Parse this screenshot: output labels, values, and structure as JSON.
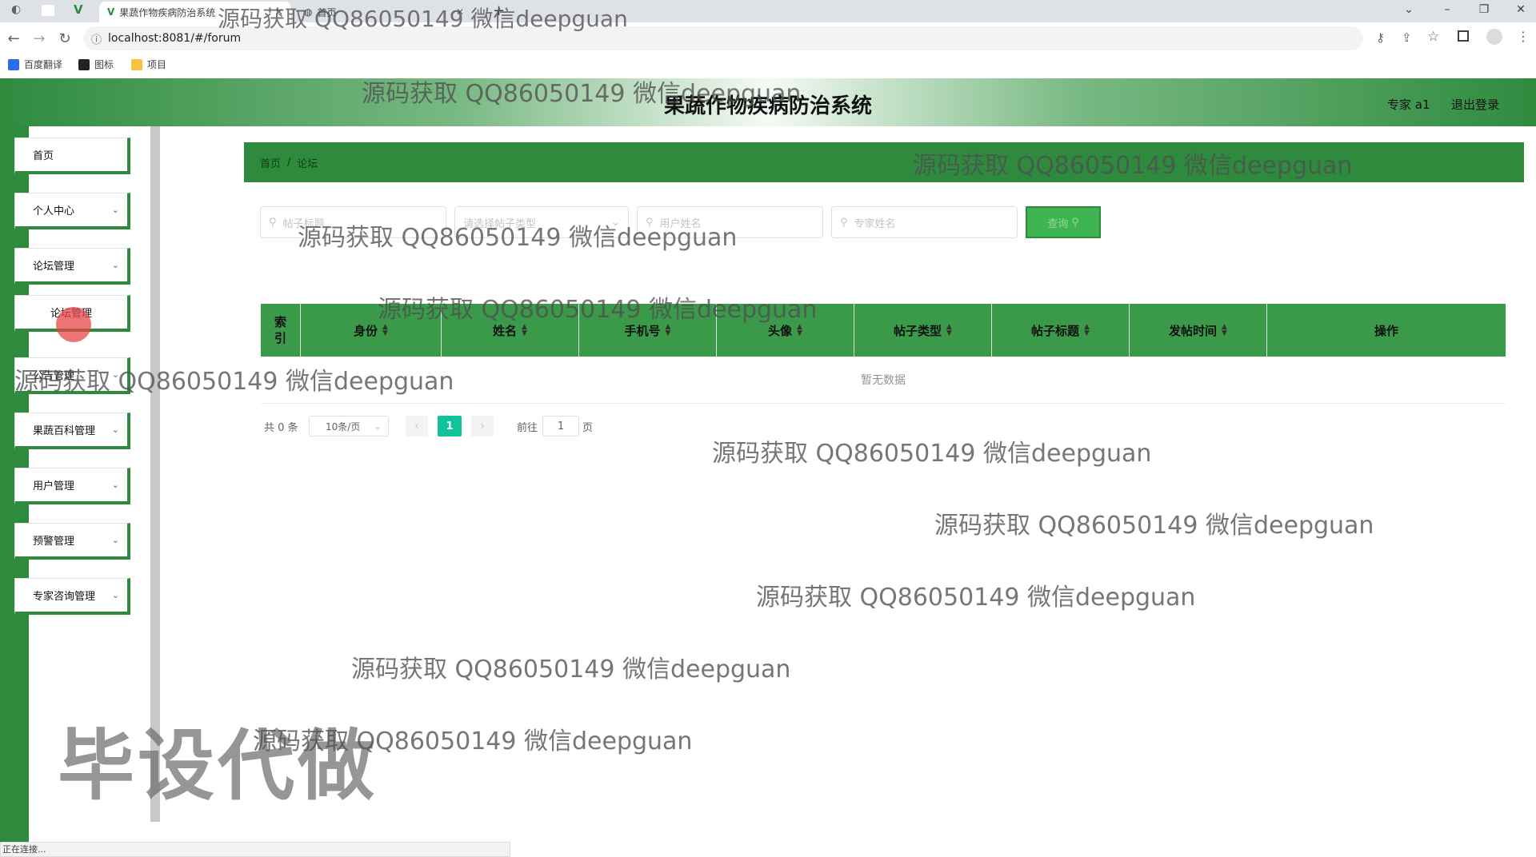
{
  "browser": {
    "tabs": [
      {
        "label": "果蔬作物疾病防治系统",
        "close": "✕",
        "active": true
      },
      {
        "label": "首页",
        "close": "✕",
        "active": false
      }
    ],
    "new_tab": "+",
    "url": "localhost:8081/#/forum",
    "bookmarks": [
      {
        "label": "百度翻译",
        "color": "#2b6de8"
      },
      {
        "label": "图标",
        "color": "#222222"
      },
      {
        "label": "项目",
        "color": "#f5c242"
      }
    ],
    "status_text": "正在连接..."
  },
  "app": {
    "title": "果蔬作物疾病防治系统",
    "user_label": "专家 a1",
    "logout_label": "退出登录",
    "theme_color": "#2e8b3e"
  },
  "sidebar": {
    "items": [
      {
        "label": "首页",
        "has_children": false
      },
      {
        "label": "个人中心",
        "has_children": true
      },
      {
        "label": "论坛管理",
        "has_children": true
      },
      {
        "label": "论坛管理",
        "has_children": false,
        "sub": true
      },
      {
        "label": "公告管理",
        "has_children": true
      },
      {
        "label": "果蔬百科管理",
        "has_children": true
      },
      {
        "label": "用户管理",
        "has_children": true
      },
      {
        "label": "预警管理",
        "has_children": true
      },
      {
        "label": "专家咨询管理",
        "has_children": true
      }
    ],
    "chevron": "⌄"
  },
  "breadcrumb": {
    "home": "首页",
    "separator": "/",
    "current": "论坛"
  },
  "search": {
    "post_title_placeholder": "帖子标题",
    "post_type_placeholder": "请选择帖子类型",
    "user_name_placeholder": "用户姓名",
    "expert_name_placeholder": "专家姓名",
    "query_button": "查询"
  },
  "table": {
    "columns": [
      "索引",
      "身份",
      "姓名",
      "手机号",
      "头像",
      "帖子类型",
      "帖子标题",
      "发帖时间",
      "操作"
    ],
    "empty_text": "暂无数据"
  },
  "pagination": {
    "total": "共 0 条",
    "page_size": "10条/页",
    "current_page": "1",
    "goto_label": "前往",
    "goto_value": "1",
    "page_unit": "页"
  },
  "watermarks": {
    "text": "源码获取 QQ86050149 微信deepguan",
    "big": "毕设代做"
  }
}
